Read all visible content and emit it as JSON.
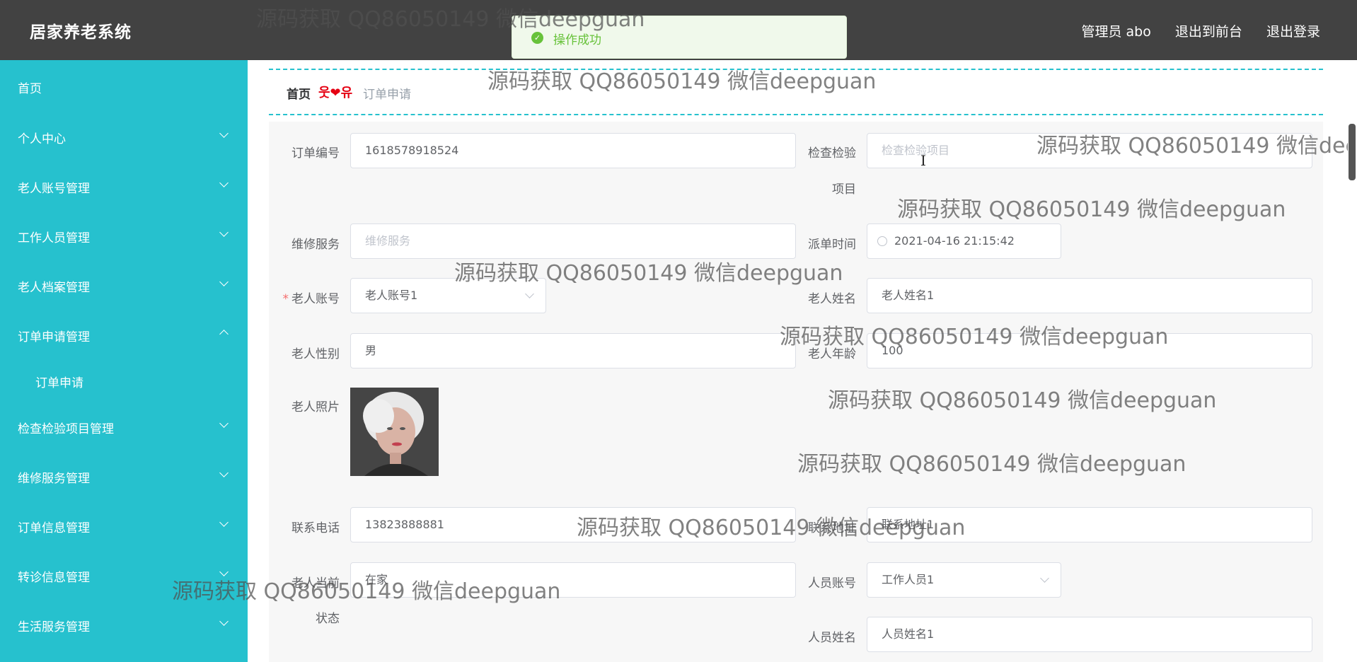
{
  "header": {
    "brand": "居家养老系统",
    "admin": "管理员 abo",
    "exit_front": "退出到前台",
    "logout": "退出登录"
  },
  "toast": {
    "message": "操作成功"
  },
  "sidebar": {
    "items": [
      {
        "label": "首页"
      },
      {
        "label": "个人中心"
      },
      {
        "label": "老人账号管理"
      },
      {
        "label": "工作人员管理"
      },
      {
        "label": "老人档案管理"
      },
      {
        "label": "订单申请管理"
      },
      {
        "label": "订单申请"
      },
      {
        "label": "检查检验项目管理"
      },
      {
        "label": "维修服务管理"
      },
      {
        "label": "订单信息管理"
      },
      {
        "label": "转诊信息管理"
      },
      {
        "label": "生活服务管理"
      }
    ]
  },
  "breadcrumb": {
    "home": "首页",
    "separator": "웃❤유",
    "current": "订单申请"
  },
  "form": {
    "order_no": {
      "label": "订单编号",
      "value": "1618578918524"
    },
    "check_item": {
      "label_line1": "检查检验",
      "label_line2": "项目",
      "placeholder": "检查检验项目"
    },
    "repair": {
      "label": "维修服务",
      "placeholder": "维修服务"
    },
    "dispatch_time": {
      "label": "派单时间",
      "value": "2021-04-16 21:15:42"
    },
    "elder_account": {
      "required": "*",
      "label": "老人账号",
      "value": "老人账号1"
    },
    "elder_name": {
      "label": "老人姓名",
      "value": "老人姓名1"
    },
    "elder_gender": {
      "label": "老人性别",
      "value": "男"
    },
    "elder_age": {
      "label": "老人年龄",
      "value": "100"
    },
    "elder_photo": {
      "label": "老人照片"
    },
    "phone": {
      "label": "联系电话",
      "value": "13823888881"
    },
    "address": {
      "label": "联系地址",
      "value": "联系地址1"
    },
    "status": {
      "label_line1": "老人当前",
      "label_line2": "状态",
      "value": "在家"
    },
    "staff_account": {
      "label": "人员账号",
      "value": "工作人员1"
    },
    "staff_name": {
      "label": "人员姓名",
      "value": "人员姓名1"
    }
  },
  "watermark": "源码获取 QQ86050149 微信deepguan",
  "colors": {
    "sidebar": "#26c1ce",
    "header": "#424242",
    "success": "#67c23a"
  }
}
